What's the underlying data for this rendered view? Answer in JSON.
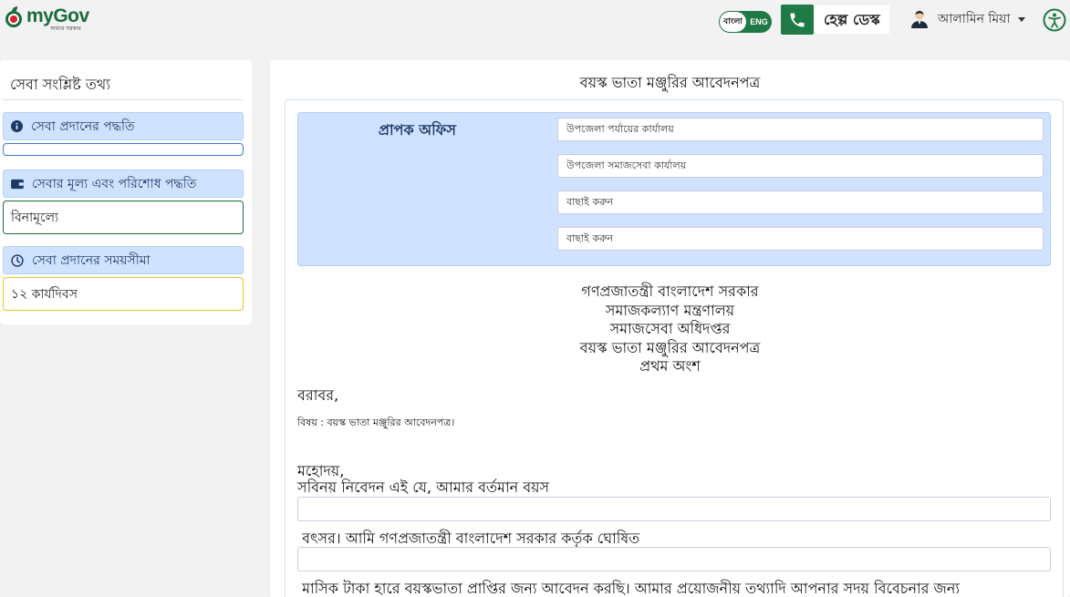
{
  "header": {
    "logo_title": "myGov",
    "logo_subtitle": "আমার সরকার",
    "lang_bn": "বাংলা",
    "lang_en": "ENG",
    "helpdesk_label": "হেল্প ডেস্ক",
    "user_name": "আলামিন মিয়া"
  },
  "sidebar": {
    "title": "সেবা সংশ্লিষ্ট তথ্য",
    "sections": [
      {
        "heading": "সেবা প্রদানের পদ্ধতি",
        "value": ""
      },
      {
        "heading": "সেবার মূল্য এবং পরিশোধ পদ্ধতি",
        "value": "বিনামূল্যে"
      },
      {
        "heading": "সেবা প্রদানের সময়সীমা",
        "value": "১২ কার্যদিবস"
      }
    ]
  },
  "form": {
    "title": "বয়স্ক ভাতা মঞ্জুরির আবেদনপত্র",
    "office_label": "প্রাপক অফিস",
    "office_selects": [
      "উপজেলা পর্যায়ের কার্যালয়",
      "উপজেলা সমাজসেবা কার্যালয়",
      "বাছাই করুন",
      "বাছাই করুন"
    ],
    "heading_lines": [
      "গণপ্রজাতন্ত্রী বাংলাদেশ সরকার",
      "সমাজকল্যাণ মন্ত্রণালয়",
      "সমাজসেবা অধিদপ্তর",
      "বয়স্ক ভাতা মঞ্জুরির আবেদনপত্র",
      "প্রথম অংশ"
    ],
    "to": "বরাবর,",
    "subject": "বিষয় : বয়স্ক ভাতা মঞ্জুরির আবেদনপত্র।",
    "salutation": "মহোদয়,",
    "body_line1": "সবিনয় নিবেদন এই যে, আমার বর্তমান বয়স",
    "body_line2": " বৎসর। আমি গণপ্রজাতন্ত্রী বাংলাদেশ সরকার কর্তৃক ঘোষিত",
    "body_line3": " মাসিক টাকা হারে বয়স্কভাতা প্রাপ্তির জন্য আবেদন করছি। আমার প্রয়োজনীয় তথ্যাদি আপনার সদয় বিবেচনার জন্য"
  },
  "colors": {
    "brand_green": "#1f7a45",
    "info_blue": "#cfe2ff",
    "box_border_green": "#1a6b3c",
    "box_border_yellow": "#f0c419",
    "box_border_blue": "#3a7bd5"
  }
}
